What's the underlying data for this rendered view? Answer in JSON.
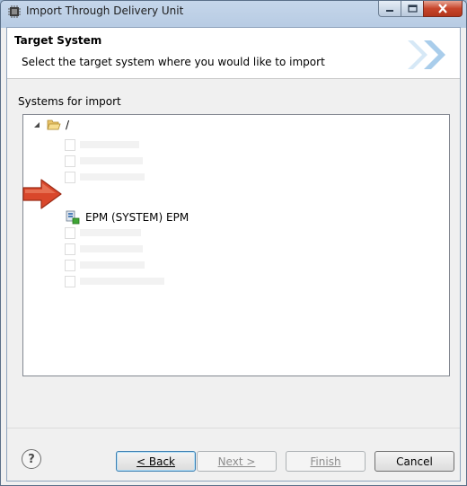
{
  "window": {
    "title": "Import Through Delivery Unit",
    "icons": {
      "app": "chip-icon",
      "minimize": "minimize-icon",
      "maximize": "maximize-icon",
      "close": "close-icon"
    }
  },
  "banner": {
    "title": "Target System",
    "description": "Select the target system where you would like to import",
    "graphic_icon": "double-chevron-right-icon"
  },
  "systems": {
    "group_label": "Systems for import",
    "root": {
      "label": "/",
      "expanded": true,
      "icon": "folder-open-icon"
    },
    "selected_item": {
      "label": "EPM (SYSTEM) EPM",
      "icon": "system-connected-icon"
    }
  },
  "annotation": {
    "icon": "red-arrow-icon",
    "color": "#d9472b"
  },
  "buttons": {
    "back": "< Back",
    "next": "Next >",
    "finish": "Finish",
    "cancel": "Cancel"
  },
  "help_icon": "help-icon"
}
